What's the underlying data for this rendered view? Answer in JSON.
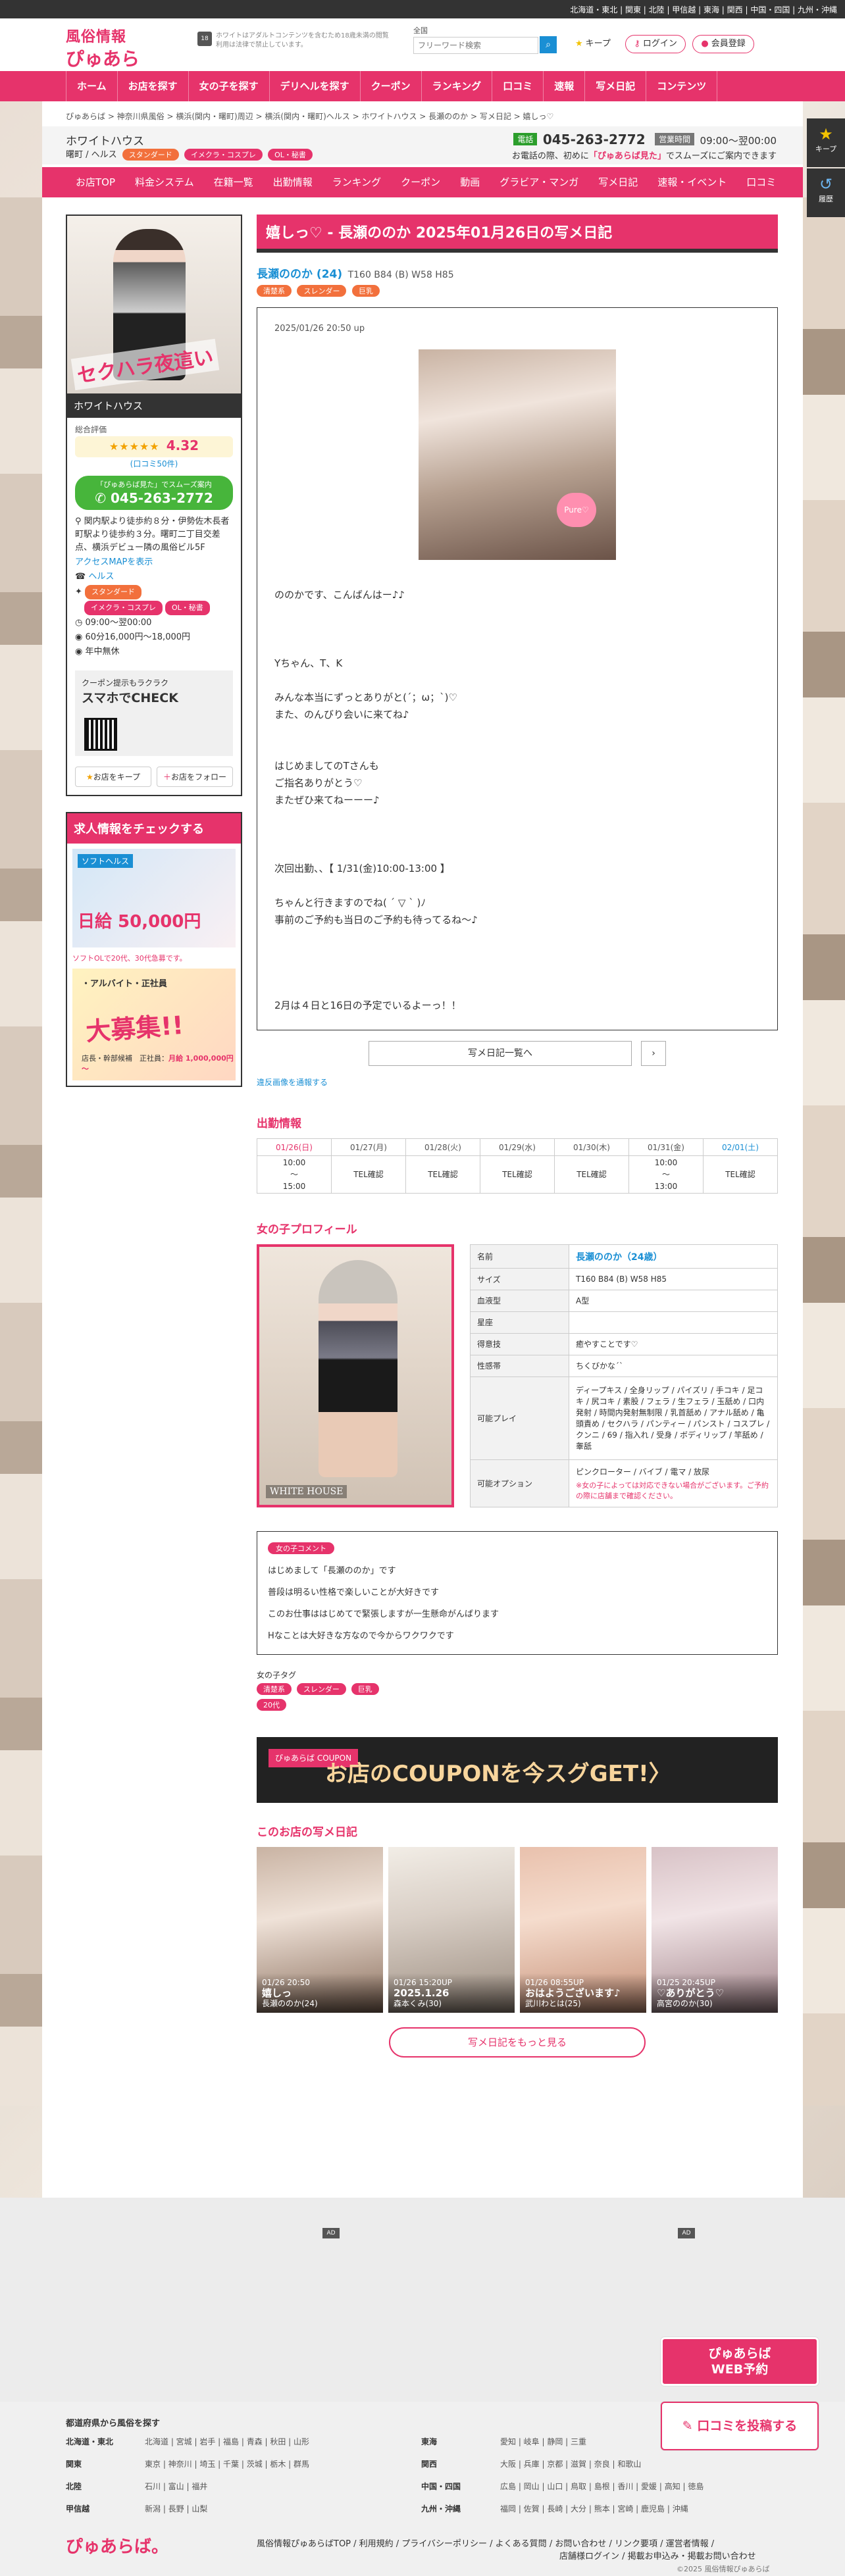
{
  "topbar": {
    "regions": "北海道・東北 | 関東 | 北陸 | 甲信越 | 東海 | 関西 | 中国・四国 | 九州・沖縄"
  },
  "header": {
    "logo_top": "風俗情報",
    "logo_main": "ぴゅあらば。",
    "age_note": "ホワイトはアダルトコンテンツを含むため18歳未満の閲覧利用は法律で禁止しています。",
    "age_badge": "18",
    "search_label": "全国",
    "search_placeholder": "フリーワード検索",
    "keep": "キープ",
    "login": "ログイン",
    "register": "会員登録"
  },
  "gnav": [
    "ホーム",
    "お店を探す",
    "女の子を探す",
    "デリヘルを探す",
    "クーポン",
    "ランキング",
    "口コミ",
    "速報",
    "写メ日記",
    "コンテンツ"
  ],
  "breadcrumb": "ぴゅあらば > 神奈川県風俗 > 横浜(関内・曙町)周辺 > 横浜(関内・曙町)ヘルス > ホワイトハウス > 長瀬ののか > 写メ日記 > 嬉しっ♡",
  "shop": {
    "name": "ホワイトハウス",
    "area": "曙町 / ヘルス",
    "tags": [
      "スタンダード",
      "イメクラ・コスプレ",
      "OL・秘書"
    ],
    "tel_label": "電話",
    "tel": "045-263-2772",
    "hours_label": "営業時間",
    "hours": "09:00～翌00:00",
    "note_pre": "お電話の際、初めに",
    "note_em": "「ぴゅあらば見た」",
    "note_post": "でスムーズにご案内できます"
  },
  "shopnav": [
    "お店TOP",
    "料金システム",
    "在籍一覧",
    "出勤情報",
    "ランキング",
    "クーポン",
    "動画",
    "グラビア・マンガ",
    "写メ日記",
    "速報・イベント",
    "口コミ"
  ],
  "sidetabs": {
    "keep": "キープ",
    "history": "履歴"
  },
  "sidebar": {
    "slogan": "セクハラ夜這い",
    "caption": "ホワイトハウス",
    "rating_title": "総合評価",
    "stars": "★★★★★",
    "rating": "4.32",
    "reviews": "(口コミ50件)",
    "tel_note": "「ぴゅあらば見た」でスムーズ案内",
    "tel": "045-263-2772",
    "access": "関内駅より徒歩約８分・伊勢佐木長者町駅より徒歩約３分。曙町二丁目交差点、横浜デビュー隣の風俗ビル5F",
    "map_link": "アクセスMAPを表示",
    "genre": "ヘルス",
    "tags": [
      "スタンダード",
      "イメクラ・コスプレ",
      "OL・秘書"
    ],
    "hours": "09:00～翌00:00",
    "price": "60分16,000円～18,000円",
    "holiday": "年中無休",
    "qr_small": "クーポン提示もラクラク",
    "qr_big": "スマホでCHECK",
    "keep_btn": "お店をキープ",
    "follow_btn": "お店をフォロー"
  },
  "recruit": {
    "title": "求人情報をチェックする",
    "b1_top": "ソフトヘルス",
    "b1_main": "日給 50,000円",
    "b1_foot": "ソフトOLで20代、30代急募です。",
    "b2_top": "・アルバイト・正社員",
    "b2_main": "大募集!!",
    "b2_foot_pre": "店長・幹部候補　正社員：",
    "b2_foot_em": "月給 1,000,000円～"
  },
  "diary": {
    "title": "嬉しっ♡ - 長瀬ののか 2025年01月26日の写メ日記",
    "girl_name": "長瀬ののか (24)",
    "girl_size": "T160 B84 (B) W58 H85",
    "girl_tags": [
      "清楚系",
      "スレンダー",
      "巨乳"
    ],
    "posted": "2025/01/26 20:50 up",
    "photo_badge": "Pure♡",
    "body": "ののかです、こんばんはー♪♪\n\n\n\nYちゃん、T、K\n\nみんな本当にずっとありがと(´；ω；`)♡\nまた、のんびり会いに来てね♪\n\n\nはじめましてのTさんも\nご指名ありがとう♡\nまたぜひ来てねーーー♪\n\n\n\n次回出勤、、【 1/31(金)10:00-13:00 】\n\nちゃんと行きますのでね( ´ ▽ ` )ﾉ\n事前のご予約も当日のご予約も待ってるね～♪\n\n\n\n\n2月は４日と16日の予定でいるよーっ！！",
    "list_btn": "写メ日記一覧へ",
    "report": "違反画像を通報する"
  },
  "schedule": {
    "title": "出勤情報",
    "days": [
      {
        "d": "01/26(日)",
        "v": "10:00\n～\n15:00"
      },
      {
        "d": "01/27(月)",
        "v": "TEL確認"
      },
      {
        "d": "01/28(火)",
        "v": "TEL確認"
      },
      {
        "d": "01/29(水)",
        "v": "TEL確認"
      },
      {
        "d": "01/30(木)",
        "v": "TEL確認"
      },
      {
        "d": "01/31(金)",
        "v": "10:00\n～\n13:00"
      },
      {
        "d": "02/01(土)",
        "v": "TEL確認"
      }
    ]
  },
  "profile": {
    "title": "女の子プロフィール",
    "img_logo": "WHITE HOUSE",
    "rows": [
      {
        "k": "名前",
        "v": "長瀬ののか（24歳）"
      },
      {
        "k": "サイズ",
        "v": "T160 B84 (B) W58 H85"
      },
      {
        "k": "血液型",
        "v": "A型"
      },
      {
        "k": "星座",
        "v": ""
      },
      {
        "k": "得意技",
        "v": "癒やすことです♡"
      },
      {
        "k": "性感帯",
        "v": "ちくびかな´`"
      },
      {
        "k": "可能プレイ",
        "v": "ディープキス / 全身リップ / パイズリ / 手コキ / 足コキ / 尻コキ / 素股 / フェラ / 生フェラ / 玉舐め / 口内発射 / 時間内発射無制限 / 乳首舐め / アナル舐め / 亀頭責め / セクハラ / パンティー / パンスト / コスプレ / クンニ / 69 / 指入れ / 受身 / ボディリップ / 竿舐め / 睾舐"
      },
      {
        "k": "可能オプション",
        "v": "ピンクローター / バイブ / 電マ / 放尿",
        "note": "※女の子によっては対応できない場合がございます。ご予約の際に店舗まで確認ください。"
      }
    ]
  },
  "comment": {
    "label": "女の子コメント",
    "lines": [
      "はじめまして「長瀬ののか」です",
      "普段は明るい性格で楽しいことが大好きです",
      "このお仕事ははじめてで緊張しますが一生懸命がんばります",
      "Hなことは大好きな方なので今からワクワクです"
    ]
  },
  "girl_tags": {
    "label": "女の子タグ",
    "tags": [
      "清楚系",
      "スレンダー",
      "巨乳",
      "20代"
    ]
  },
  "coupon": {
    "label": "ぴゅあらば COUPON",
    "text": "お店のCOUPONを今スグGET!〉"
  },
  "shop_diaries": {
    "title": "このお店の写メ日記",
    "items": [
      {
        "date": "01/26 20:50",
        "title": "嬉しっ",
        "name": "長瀬ののか(24)"
      },
      {
        "date": "01/26 15:20UP",
        "title": "2025.1.26",
        "name": "森本くみ(30)"
      },
      {
        "date": "01/26 08:55UP",
        "title": "おはようございます♪",
        "name": "武川わとは(25)"
      },
      {
        "date": "01/25 20:45UP",
        "title": "♡ありがとう♡",
        "name": "高宮ののか(30)"
      }
    ],
    "more": "写メ日記をもっと見る"
  },
  "ads": {
    "label": "AD"
  },
  "float": {
    "reserve1": "ぴゅあらば",
    "reserve2": "WEB予約",
    "review": "口コミを投稿する"
  },
  "footer": {
    "title": "都道府県から風俗を探す",
    "left": [
      {
        "k": "北海道・東北",
        "v": "北海道 | 宮城 | 岩手 | 福島 | 青森 | 秋田 | 山形"
      },
      {
        "k": "関東",
        "v": "東京 | 神奈川 | 埼玉 | 千葉 | 茨城 | 栃木 | 群馬"
      },
      {
        "k": "北陸",
        "v": "石川 | 富山 | 福井"
      },
      {
        "k": "甲信越",
        "v": "新潟 | 長野 | 山梨"
      }
    ],
    "right": [
      {
        "k": "東海",
        "v": "愛知 | 岐阜 | 静岡 | 三重"
      },
      {
        "k": "関西",
        "v": "大阪 | 兵庫 | 京都 | 滋賀 | 奈良 | 和歌山"
      },
      {
        "k": "中国・四国",
        "v": "広島 | 岡山 | 山口 | 鳥取 | 島根 | 香川 | 愛媛 | 高知 | 徳島"
      },
      {
        "k": "九州・沖縄",
        "v": "福岡 | 佐賀 | 長崎 | 大分 | 熊本 | 宮崎 | 鹿児島 | 沖縄"
      }
    ],
    "logo": "ぴゅあらば。",
    "links1": "風俗情報ぴゅあらばTOP / 利用規約 / プライバシーポリシー / よくある質問 / お問い合わせ / リンク要項 / 運営者情報 /",
    "links2": "店舗様ログイン / 掲載お申込み・掲載お問い合わせ",
    "copy": "©2025 風俗情報ぴゅあらば"
  },
  "colors": {
    "brand": "#e6336b",
    "link": "#1a8fd4",
    "tel": "#47b53b",
    "tag": "#f2703c"
  }
}
